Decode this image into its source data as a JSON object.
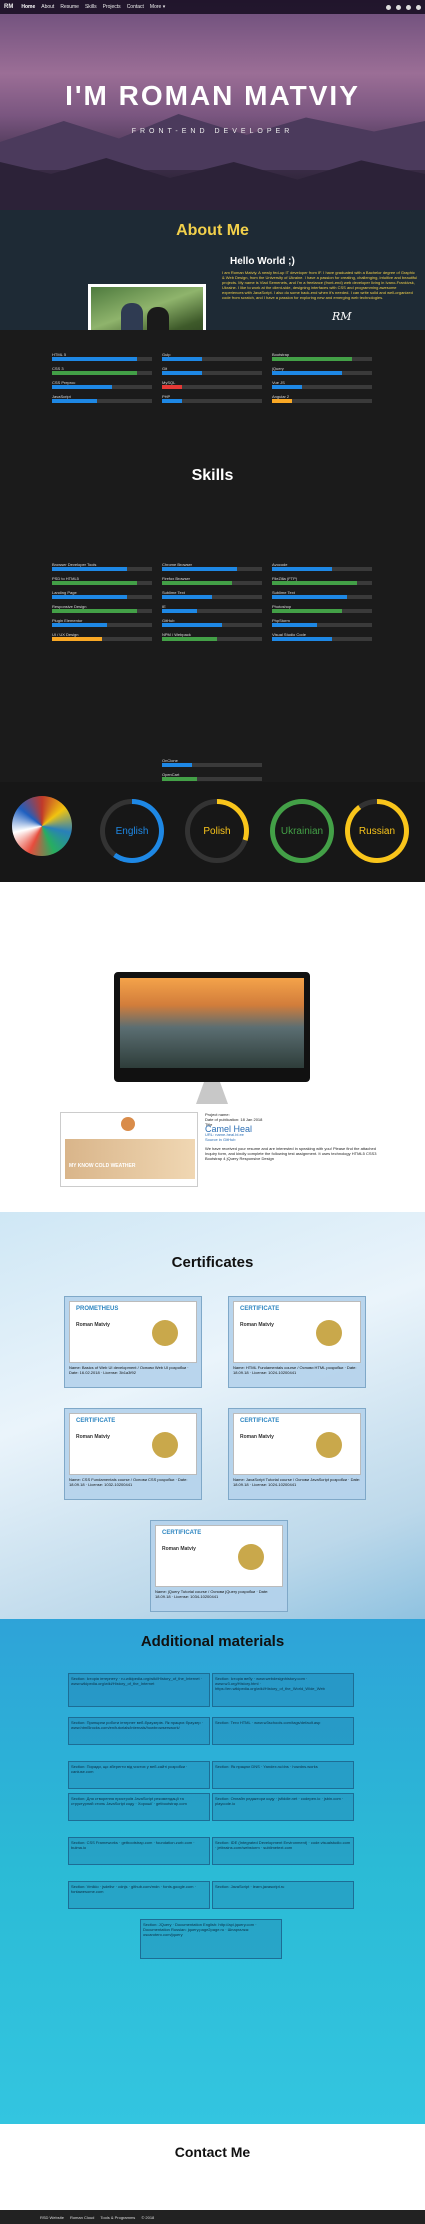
{
  "nav": {
    "brand": "RM",
    "links": [
      "Home",
      "About",
      "Resume",
      "Skills",
      "Projects",
      "Contact",
      "More ▾"
    ]
  },
  "hero": {
    "title": "I'M ROMAN MATVIY",
    "subtitle": "FRONT-END DEVELOPER"
  },
  "about": {
    "title": "About Me",
    "greeting": "Hello World ;)",
    "text": "I am Roman Matviy. A newly fed-up IT developer from IF. I have graduated with a Bachelor degree of Graphic & Web Design, from the University of Ukraine. I have a passion for creating, challenging, intuitive and beautiful projects. My name is Vlad Semenets, and I'm a freelance (front-end) web developer living in Ivano-Frankivsk, Ukraine. I like to work at the client-side, designing interfaces with CSS and programming awesome experiences with JavaScript. I also do some back-end when it's needed. I can write solid and well-organized code from scratch, and I have a passion for exploring new and emerging web technologies.",
    "signature": "RM"
  },
  "skills": {
    "title": "Skills",
    "bars": [
      {
        "name": "HTML 5",
        "pct": 0.85,
        "color": "#1e88e5"
      },
      {
        "name": "Gulp",
        "pct": 0.4,
        "color": "#1e88e5"
      },
      {
        "name": "Bootstrap",
        "pct": 0.8,
        "color": "#43a047"
      },
      {
        "name": "CSS 3",
        "pct": 0.85,
        "color": "#43a047"
      },
      {
        "name": "Git",
        "pct": 0.4,
        "color": "#1e88e5"
      },
      {
        "name": "jQuery",
        "pct": 0.7,
        "color": "#1e88e5"
      },
      {
        "name": "CSS Preproc",
        "pct": 0.6,
        "color": "#1e88e5"
      },
      {
        "name": "MySQL",
        "pct": 0.2,
        "color": "#e53935"
      },
      {
        "name": "Vue JS",
        "pct": 0.3,
        "color": "#1e88e5"
      },
      {
        "name": "JavaScript",
        "pct": 0.45,
        "color": "#1e88e5"
      },
      {
        "name": "PHP",
        "pct": 0.2,
        "color": "#1e88e5"
      },
      {
        "name": "Angular 2",
        "pct": 0.2,
        "color": "#f9a825"
      },
      {
        "name": "Browser Developer Tools",
        "pct": 0.75,
        "color": "#1e88e5"
      },
      {
        "name": "Chrome Browser",
        "pct": 0.75,
        "color": "#1e88e5"
      },
      {
        "name": "Avocode",
        "pct": 0.6,
        "color": "#1e88e5"
      },
      {
        "name": "PSD to HTML5",
        "pct": 0.85,
        "color": "#43a047"
      },
      {
        "name": "Firefox Browser",
        "pct": 0.7,
        "color": "#43a047"
      },
      {
        "name": "FileZilla (FTP)",
        "pct": 0.85,
        "color": "#43a047"
      },
      {
        "name": "Landing Page",
        "pct": 0.75,
        "color": "#1e88e5"
      },
      {
        "name": "Sublime Text",
        "pct": 0.5,
        "color": "#1e88e5"
      },
      {
        "name": "Sublime Text",
        "pct": 0.75,
        "color": "#1e88e5"
      },
      {
        "name": "Responsive Design",
        "pct": 0.85,
        "color": "#43a047"
      },
      {
        "name": "IE",
        "pct": 0.35,
        "color": "#1e88e5"
      },
      {
        "name": "Photoshop",
        "pct": 0.7,
        "color": "#43a047"
      },
      {
        "name": "Plugin Elementor",
        "pct": 0.55,
        "color": "#1e88e5"
      },
      {
        "name": "GitHub",
        "pct": 0.6,
        "color": "#1e88e5"
      },
      {
        "name": "PhpStorm",
        "pct": 0.45,
        "color": "#1e88e5"
      },
      {
        "name": "UI / UX Design",
        "pct": 0.5,
        "color": "#f9a825"
      },
      {
        "name": "NPM / Webpack",
        "pct": 0.55,
        "color": "#43a047"
      },
      {
        "name": "Visual Studio Code",
        "pct": 0.6,
        "color": "#1e88e5"
      },
      {
        "name": "OnClone",
        "pct": 0.3,
        "color": "#1e88e5"
      },
      {
        "name": "OpenCart",
        "pct": 0.35,
        "color": "#43a047"
      },
      {
        "name": "WordPress",
        "pct": 0.5,
        "color": "#1e88e5"
      }
    ]
  },
  "languages": [
    {
      "name": "English",
      "pct": 0.6,
      "color": "#1e88e5"
    },
    {
      "name": "Polish",
      "pct": 0.3,
      "color": "#f9c51b"
    },
    {
      "name": "Ukrainian",
      "pct": 1.0,
      "color": "#43a047"
    },
    {
      "name": "Russian",
      "pct": 0.9,
      "color": "#f9c51b"
    }
  ],
  "project": {
    "label": "Project name:",
    "date": "Date of publication: 18 Jan 2018",
    "title_label": "Title",
    "title": "Camel Heal",
    "url_label": "URL: name-heal.bl.ee",
    "source": "Source in GitHub",
    "banner": "MY KNOW COLD WEATHER",
    "desc": "We have received your resume and are interested in speaking with you! Please find the attached Inquiry form, and kindly complete the following test assignment. It uses technology HTML5 CSS3 Bootstrap 4 jQuery Responsive Design"
  },
  "certs": {
    "title": "Certificates",
    "items": [
      {
        "head": "PROMETHEUS",
        "name": "Roman Matviy",
        "meta": "Name: Basics of Web UI development / Основи Web UI розробки · Date: 16.02.2018 · License: 3b1a3f92"
      },
      {
        "head": "CERTIFICATE",
        "name": "Roman Matviy",
        "meta": "Name: HTML Fundamentals course / Основи HTML розробки · Date: 18.09.18 · License: 1024-10200441"
      },
      {
        "head": "CERTIFICATE",
        "name": "Roman Matviy",
        "meta": "Name: CSS Fundamentals course / Основи CSS розробки · Date: 18.09.18 · License: 1032-10200441"
      },
      {
        "head": "CERTIFICATE",
        "name": "Roman Matviy",
        "meta": "Name: JavaScript Tutorial course / Основи JavaScript розробки · Date: 18.09.18 · License: 1024-10200441"
      },
      {
        "head": "CERTIFICATE",
        "name": "Roman Matviy",
        "meta": "Name: jQuery Tutorial course / Основи jQuery розробки · Date: 18.09.18 · License: 1034-10200441"
      }
    ]
  },
  "extra": {
    "title": "Additional materials",
    "items": [
      "Section: Історія інтернету · ru.wikipedia.org/wiki/History_of_the_Internet · www.wikipedia.org/wiki/History_of_the_Internet",
      "Section: Історія вебу · www.webdesignhistory.com · www.w3.org/History.html · https://en.wikipedia.org/wiki/History_of_the_World_Wide_Web",
      "Section: Принципи роботи інтернет веб-браузерів. Як працює браузер · www.html5rocks.com/en/tutorials/internals/howbrowserswork/",
      "Section: Теги HTML · www.w3schools.com/tags/default.asp",
      "Section: Поради, що зберегти від чистих у веб-сайті розробки · caniuse.com",
      "Section: Як працює DNS · Yandex.ru/dns · howdns.works",
      "Section: Для створення пристроїв JavaScript рекомендації та структурний стиль JavaScript коду · Хорошії · getbootstrap.com",
      "Section: Онлайн редактори коду · jsfiddle.net · codepen.io · jsbin.com · playcode.io",
      "Section: CSS Frameworks · getbootstrap.com · foundation.zurb.com · bulma.io",
      "Section: IDE (Integrated Development Environment) · code.visualstudio.com · jetbrains.com/webstorm · sublimetext.com",
      "Section: Vmikio · jsdelivr · cdnjs · github.com/mdn · fonts.google.com · fontawesome.com",
      "Section: JavaScript · learn.javascript.ru",
      "Section: JQuery · Documentation English: http://api.jquery.com · Documentation Russian: jquery.page2page.ru · Шпаргалка: oscarotero.com/jquery"
    ]
  },
  "contact": {
    "title": "Contact Me"
  },
  "footer": {
    "items": [
      "RSD Website",
      "Roman Cloud",
      "Tools & Programms",
      "© 2018"
    ]
  }
}
